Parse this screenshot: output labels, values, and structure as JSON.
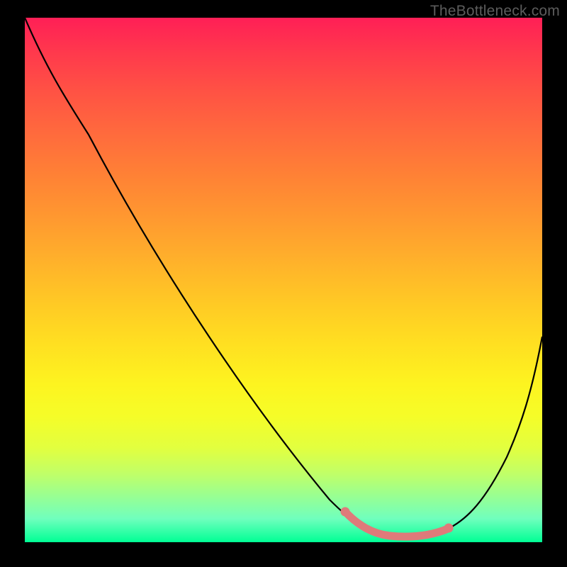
{
  "watermark": "TheBottleneck.com",
  "chart_data": {
    "type": "line",
    "title": "",
    "xlabel": "",
    "ylabel": "",
    "xlim": [
      0,
      100
    ],
    "ylim": [
      0,
      100
    ],
    "grid": false,
    "legend": false,
    "gradient_colors_top_to_bottom": [
      "#ff1f56",
      "#ff8135",
      "#ffdf21",
      "#00ff95"
    ],
    "series": [
      {
        "name": "main-curve",
        "color": "#000000",
        "x": [
          0,
          7,
          14,
          21,
          28,
          35,
          42,
          49,
          56,
          60,
          63,
          66,
          70,
          75,
          80,
          83,
          86,
          90,
          94,
          97,
          100
        ],
        "y": [
          100,
          90,
          80,
          70,
          60,
          50,
          40,
          30,
          20,
          13,
          8,
          4.5,
          2,
          1.3,
          1.3,
          2,
          4.5,
          10,
          20,
          30,
          40
        ]
      },
      {
        "name": "highlight-segment",
        "color": "#e27a7a",
        "x": [
          63,
          66,
          70,
          75,
          80,
          83
        ],
        "y": [
          8,
          4.5,
          2,
          1.3,
          1.3,
          2
        ]
      }
    ],
    "highlight_endpoints": [
      {
        "x": 63,
        "y": 8
      },
      {
        "x": 83,
        "y": 2
      }
    ]
  }
}
